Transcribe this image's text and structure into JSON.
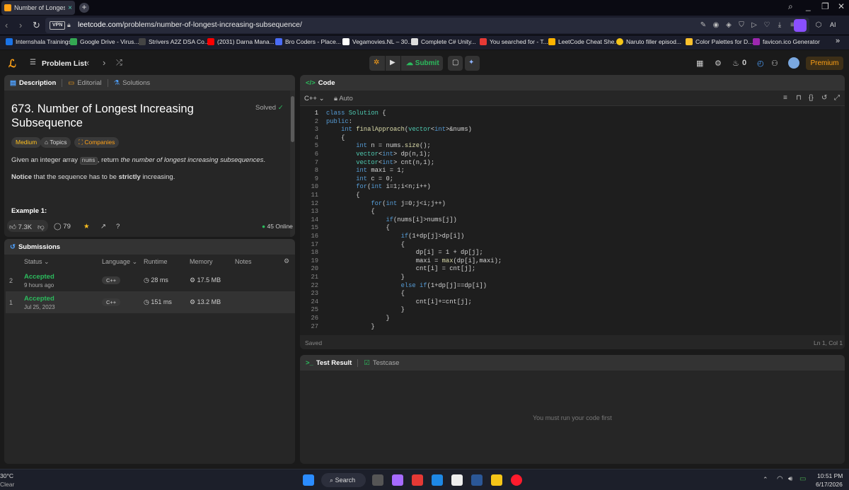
{
  "browser": {
    "tab_title": "Number of Longest In",
    "tab_close": "×",
    "new_tab": "+",
    "vpn": "VPN",
    "url_host": "leetcode.com",
    "url_path": "/problems/number-of-longest-increasing-subsequence/",
    "ai_label": "AI",
    "bookmarks": [
      {
        "label": "Internshala Trainings",
        "color": "#1a73e8"
      },
      {
        "label": "Google Drive - Virus...",
        "color": "#34a853"
      },
      {
        "label": "Strivers A2Z DSA Co...",
        "color": "#222222"
      },
      {
        "label": "(2031) Darna Mana...",
        "color": "#ff0000"
      },
      {
        "label": "Bro Coders - Place...",
        "color": "#4a6cf7"
      },
      {
        "label": "Vegamovies.NL – 30...",
        "color": "#ffffff"
      },
      {
        "label": "Complete C# Unity...",
        "color": "#dddddd"
      },
      {
        "label": "You searched for - T...",
        "color": "#e53935"
      },
      {
        "label": "LeetCode Cheat She...",
        "color": "#ffb300"
      },
      {
        "label": "Naruto filler episod...",
        "color": "#f5c518"
      },
      {
        "label": "Color Palettes for D...",
        "color": "#fbc02d"
      },
      {
        "label": "favicon.ico Generator",
        "color": "#9c27b0"
      }
    ],
    "more": "»"
  },
  "nav": {
    "problem_list": "Problem List",
    "submit": "Submit",
    "streak": "0",
    "premium": "Premium"
  },
  "left_tabs": {
    "description": "Description",
    "editorial": "Editorial",
    "solutions": "Solutions"
  },
  "problem": {
    "title": "673. Number of Longest Increasing Subsequence",
    "status": "Solved",
    "difficulty": "Medium",
    "topics": "Topics",
    "companies": "Companies",
    "desc_pre": "Given an integer array ",
    "desc_code": "nums",
    "desc_mid": ", return ",
    "desc_em": "the number of longest increasing subsequences",
    "desc_end": ".",
    "notice_bold": "Notice",
    "notice_mid": " that the sequence has to be ",
    "notice_strict": "strictly",
    "notice_end": " increasing.",
    "example": "Example 1:",
    "likes": "7.3K",
    "comments": "79",
    "online": "45 Online"
  },
  "submissions": {
    "title": "Submissions",
    "headers": {
      "status": "Status",
      "language": "Language",
      "runtime": "Runtime",
      "memory": "Memory",
      "notes": "Notes"
    },
    "rows": [
      {
        "idx": "2",
        "status": "Accepted",
        "time": "9 hours ago",
        "lang": "C++",
        "runtime": "28 ms",
        "memory": "17.5 MB"
      },
      {
        "idx": "1",
        "status": "Accepted",
        "time": "Jul 25, 2023",
        "lang": "C++",
        "runtime": "151 ms",
        "memory": "13.2 MB"
      }
    ]
  },
  "code": {
    "title": "Code",
    "language": "C++",
    "auto": "Auto",
    "saved": "Saved",
    "cursor": "Ln 1, Col 1",
    "lines": [
      "class Solution {",
      "public:",
      "    int finalApproach(vector<int>&nums)",
      "    {",
      "        int n = nums.size();",
      "        vector<int> dp(n,1);",
      "        vector<int> cnt(n,1);",
      "        int maxi = 1;",
      "        int c = 0;",
      "        for(int i=1;i<n;i++)",
      "        {",
      "            for(int j=0;j<i;j++)",
      "            {",
      "                if(nums[i]>nums[j])",
      "                {",
      "                    if(1+dp[j]>dp[i])",
      "                    {",
      "                        dp[i] = 1 + dp[j];",
      "                        maxi = max(dp[i],maxi);",
      "                        cnt[i] = cnt[j];",
      "                    }",
      "                    else if(1+dp[j]==dp[i])",
      "                    {",
      "                        cnt[i]+=cnt[j];",
      "                    }",
      "                }",
      "            }"
    ]
  },
  "test": {
    "result_tab": "Test Result",
    "testcase_tab": "Testcase",
    "empty": "You must run your code first"
  },
  "taskbar": {
    "weather_temp": "30°C",
    "weather_desc": "Clear",
    "search": "Search",
    "time": "10:51 PM",
    "date": "6/17/2026"
  }
}
